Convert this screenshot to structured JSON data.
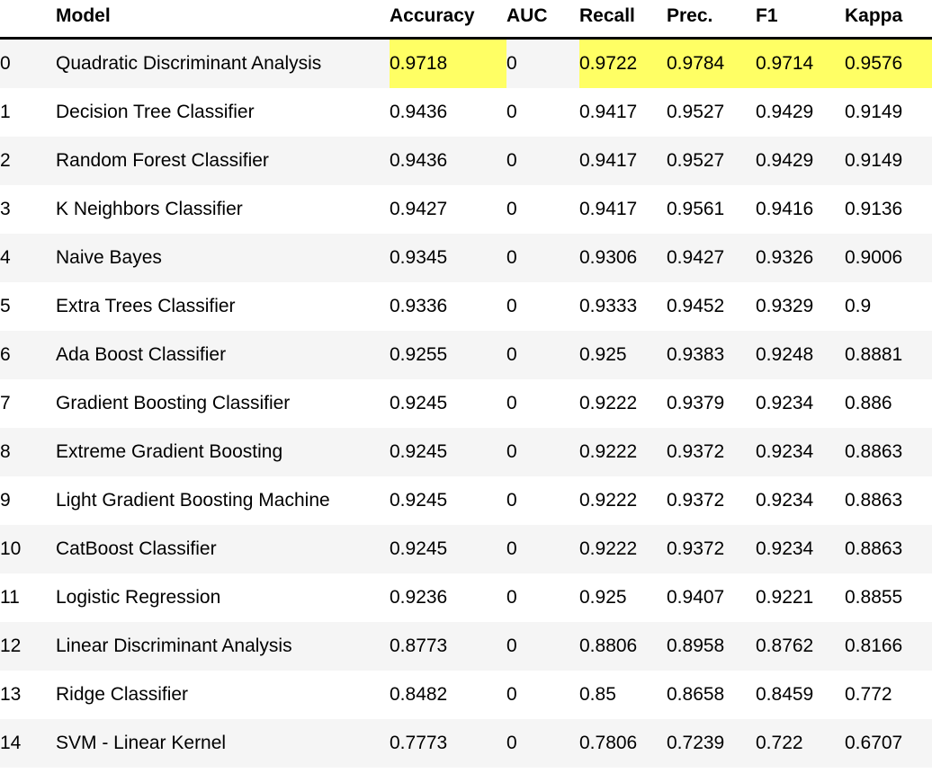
{
  "table": {
    "index_header": "",
    "columns": [
      {
        "key": "model",
        "label": "Model"
      },
      {
        "key": "accuracy",
        "label": "Accuracy"
      },
      {
        "key": "auc",
        "label": "AUC"
      },
      {
        "key": "recall",
        "label": "Recall"
      },
      {
        "key": "prec",
        "label": "Prec."
      },
      {
        "key": "f1",
        "label": "F1"
      },
      {
        "key": "kappa",
        "label": "Kappa"
      }
    ],
    "highlight_color": "#ffff64",
    "stripe_color": "#f5f5f5",
    "rows": [
      {
        "index": "0",
        "model": "Quadratic Discriminant Analysis",
        "accuracy": "0.9718",
        "auc": "0",
        "recall": "0.9722",
        "prec": "0.9784",
        "f1": "0.9714",
        "kappa": "0.9576",
        "highlight": [
          "accuracy",
          "recall",
          "prec",
          "f1",
          "kappa"
        ]
      },
      {
        "index": "1",
        "model": "Decision Tree Classifier",
        "accuracy": "0.9436",
        "auc": "0",
        "recall": "0.9417",
        "prec": "0.9527",
        "f1": "0.9429",
        "kappa": "0.9149",
        "highlight": []
      },
      {
        "index": "2",
        "model": "Random Forest Classifier",
        "accuracy": "0.9436",
        "auc": "0",
        "recall": "0.9417",
        "prec": "0.9527",
        "f1": "0.9429",
        "kappa": "0.9149",
        "highlight": []
      },
      {
        "index": "3",
        "model": "K Neighbors Classifier",
        "accuracy": "0.9427",
        "auc": "0",
        "recall": "0.9417",
        "prec": "0.9561",
        "f1": "0.9416",
        "kappa": "0.9136",
        "highlight": []
      },
      {
        "index": "4",
        "model": "Naive Bayes",
        "accuracy": "0.9345",
        "auc": "0",
        "recall": "0.9306",
        "prec": "0.9427",
        "f1": "0.9326",
        "kappa": "0.9006",
        "highlight": []
      },
      {
        "index": "5",
        "model": "Extra Trees Classifier",
        "accuracy": "0.9336",
        "auc": "0",
        "recall": "0.9333",
        "prec": "0.9452",
        "f1": "0.9329",
        "kappa": "0.9",
        "highlight": []
      },
      {
        "index": "6",
        "model": "Ada Boost Classifier",
        "accuracy": "0.9255",
        "auc": "0",
        "recall": "0.925",
        "prec": "0.9383",
        "f1": "0.9248",
        "kappa": "0.8881",
        "highlight": []
      },
      {
        "index": "7",
        "model": "Gradient Boosting Classifier",
        "accuracy": "0.9245",
        "auc": "0",
        "recall": "0.9222",
        "prec": "0.9379",
        "f1": "0.9234",
        "kappa": "0.886",
        "highlight": []
      },
      {
        "index": "8",
        "model": "Extreme Gradient Boosting",
        "accuracy": "0.9245",
        "auc": "0",
        "recall": "0.9222",
        "prec": "0.9372",
        "f1": "0.9234",
        "kappa": "0.8863",
        "highlight": []
      },
      {
        "index": "9",
        "model": "Light Gradient Boosting Machine",
        "accuracy": "0.9245",
        "auc": "0",
        "recall": "0.9222",
        "prec": "0.9372",
        "f1": "0.9234",
        "kappa": "0.8863",
        "highlight": []
      },
      {
        "index": "10",
        "model": "CatBoost Classifier",
        "accuracy": "0.9245",
        "auc": "0",
        "recall": "0.9222",
        "prec": "0.9372",
        "f1": "0.9234",
        "kappa": "0.8863",
        "highlight": []
      },
      {
        "index": "11",
        "model": "Logistic Regression",
        "accuracy": "0.9236",
        "auc": "0",
        "recall": "0.925",
        "prec": "0.9407",
        "f1": "0.9221",
        "kappa": "0.8855",
        "highlight": []
      },
      {
        "index": "12",
        "model": "Linear Discriminant Analysis",
        "accuracy": "0.8773",
        "auc": "0",
        "recall": "0.8806",
        "prec": "0.8958",
        "f1": "0.8762",
        "kappa": "0.8166",
        "highlight": []
      },
      {
        "index": "13",
        "model": "Ridge Classifier",
        "accuracy": "0.8482",
        "auc": "0",
        "recall": "0.85",
        "prec": "0.8658",
        "f1": "0.8459",
        "kappa": "0.772",
        "highlight": []
      },
      {
        "index": "14",
        "model": "SVM - Linear Kernel",
        "accuracy": "0.7773",
        "auc": "0",
        "recall": "0.7806",
        "prec": "0.7239",
        "f1": "0.722",
        "kappa": "0.6707",
        "highlight": []
      }
    ]
  }
}
